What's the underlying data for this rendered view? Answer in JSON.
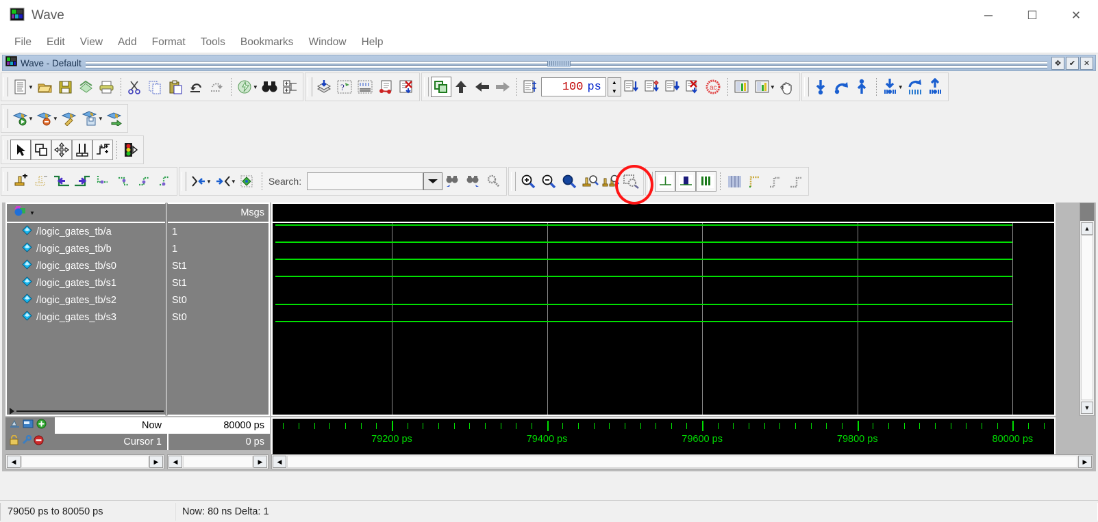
{
  "window": {
    "title": "Wave",
    "app_icon": "wave-window-icon",
    "controls": {
      "minimize": "─",
      "maximize": "☐",
      "close": "✕"
    }
  },
  "menubar": {
    "items": [
      "File",
      "Edit",
      "View",
      "Add",
      "Format",
      "Tools",
      "Bookmarks",
      "Window",
      "Help"
    ]
  },
  "pane": {
    "caption": "Wave - Default",
    "caption_icon": "wave-pane-icon",
    "buttons": [
      {
        "name": "undock-button",
        "glyph": "✥"
      },
      {
        "name": "dock-button",
        "glyph": "✔"
      },
      {
        "name": "close-pane-button",
        "glyph": "✕"
      }
    ]
  },
  "toolbars": {
    "standard": [
      {
        "name": "new-file-button",
        "icon": "new-document-icon",
        "dropdown": true
      },
      {
        "name": "open-file-button",
        "icon": "open-folder-icon"
      },
      {
        "name": "save-button",
        "icon": "floppy-disk-icon"
      },
      {
        "name": "reload-button",
        "icon": "reload-icon"
      },
      {
        "name": "print-button",
        "icon": "printer-icon"
      },
      {
        "name": "cut-button",
        "icon": "scissors-icon"
      },
      {
        "name": "copy-button",
        "icon": "copy-icon"
      },
      {
        "name": "paste-button",
        "icon": "clipboard-paste-icon"
      },
      {
        "name": "undo-button",
        "icon": "undo-arrow-icon"
      },
      {
        "name": "redo-button",
        "icon": "redo-arrow-icon"
      },
      {
        "name": "compile-button",
        "icon": "compile-icon",
        "dropdown": true
      },
      {
        "name": "find-button",
        "icon": "binoculars-icon"
      },
      {
        "name": "properties-button",
        "icon": "properties-icon"
      }
    ],
    "simulate": [
      {
        "name": "add-wave-button",
        "icon": "add-wave-icon"
      },
      {
        "name": "simulate-button",
        "icon": "simulate-icon"
      },
      {
        "name": "signal-list-button",
        "icon": "signal-list-icon"
      },
      {
        "name": "dataflow-button",
        "icon": "dataflow-icon"
      },
      {
        "name": "remove-button",
        "icon": "remove-x-icon"
      }
    ],
    "run": [
      {
        "name": "restart-button",
        "icon": "restart-icon",
        "pressed": true
      },
      {
        "name": "run-up-button",
        "icon": "arrow-up-icon"
      },
      {
        "name": "run-back-button",
        "icon": "arrow-left-icon"
      },
      {
        "name": "run-forward-button",
        "icon": "arrow-right-icon"
      },
      {
        "name": "run-length-button",
        "icon": "run-length-icon"
      }
    ],
    "run_length": {
      "value": "100",
      "unit": "ps",
      "name": "run-length-field"
    },
    "step": [
      {
        "name": "step-into-button",
        "icon": "step-into-icon"
      },
      {
        "name": "step-over-button",
        "icon": "step-over-icon"
      },
      {
        "name": "step-out-button",
        "icon": "step-out-icon"
      },
      {
        "name": "break-button",
        "icon": "break-x-icon"
      },
      {
        "name": "stop-button",
        "icon": "stop-sign-icon"
      }
    ],
    "wave_cmp": [
      {
        "name": "wave-compare-button",
        "icon": "wave-compare-icon"
      },
      {
        "name": "wave-compare-2-button",
        "icon": "wave-compare-2-icon",
        "dropdown": true
      },
      {
        "name": "pan-hand-button",
        "icon": "hand-pan-icon"
      }
    ],
    "bookmarks": [
      {
        "name": "collapse-all-button",
        "icon": "collapse-down-icon"
      },
      {
        "name": "expand-toggle-button",
        "icon": "expand-toggle-icon"
      },
      {
        "name": "expand-all-button",
        "icon": "expand-up-icon"
      },
      {
        "name": "collapse-sel-button",
        "icon": "collapse-sel-icon",
        "dropdown": true
      },
      {
        "name": "toggle-sel-button",
        "icon": "toggle-sel-icon"
      },
      {
        "name": "expand-sel-button",
        "icon": "expand-sel-icon"
      }
    ],
    "wave_row2": [
      {
        "name": "wave-run-button",
        "icon": "wave-run-icon",
        "dropdown": true
      },
      {
        "name": "wave-stop-button",
        "icon": "wave-stop-icon",
        "dropdown": true
      },
      {
        "name": "wave-edit-button",
        "icon": "wave-edit-icon"
      },
      {
        "name": "wave-save-button",
        "icon": "wave-save-icon",
        "dropdown": true
      },
      {
        "name": "wave-export-button",
        "icon": "wave-export-icon"
      }
    ],
    "edit_mode": [
      {
        "name": "select-mode-button",
        "icon": "arrow-cursor-icon",
        "pressed": true
      },
      {
        "name": "zoom-select-button",
        "icon": "zoom-rect-icon"
      },
      {
        "name": "edit-move-button",
        "icon": "move-cross-icon"
      },
      {
        "name": "edit-insert-button",
        "icon": "insert-pulse-icon"
      },
      {
        "name": "edit-props-button",
        "icon": "edit-props-icon"
      },
      {
        "name": "traffic-light-button",
        "icon": "traffic-light-icon"
      }
    ],
    "wave_edit": [
      {
        "name": "insert-cursor-button",
        "icon": "insert-cursor-icon"
      },
      {
        "name": "delete-cursor-button",
        "icon": "delete-cursor-icon"
      },
      {
        "name": "find-prev-transition-button",
        "icon": "prev-transition-icon"
      },
      {
        "name": "find-next-transition-button",
        "icon": "next-transition-icon"
      },
      {
        "name": "edge-1-button",
        "icon": "edge-dotted-1-icon"
      },
      {
        "name": "edge-2-button",
        "icon": "edge-dotted-2-icon"
      },
      {
        "name": "edge-3-button",
        "icon": "edge-dotted-3-icon"
      },
      {
        "name": "edge-4-button",
        "icon": "edge-dotted-4-icon"
      }
    ],
    "expand_time": [
      {
        "name": "expand-time-prev-button",
        "icon": "expand-time-prev-icon",
        "dropdown": true
      },
      {
        "name": "expand-time-next-button",
        "icon": "expand-time-next-icon",
        "dropdown": true
      },
      {
        "name": "expand-time-all-button",
        "icon": "expand-time-all-icon"
      }
    ],
    "search": {
      "label": "Search:",
      "value": "",
      "placeholder": "",
      "dropdown_icon": "chevron-down-icon",
      "buttons": [
        {
          "name": "search-prev-button",
          "icon": "search-prev-icon"
        },
        {
          "name": "search-next-button",
          "icon": "search-next-icon"
        },
        {
          "name": "search-options-button",
          "icon": "search-options-icon"
        }
      ]
    },
    "zoom": [
      {
        "name": "zoom-in-button",
        "icon": "zoom-in-icon"
      },
      {
        "name": "zoom-out-button",
        "icon": "zoom-out-icon"
      },
      {
        "name": "zoom-full-button",
        "icon": "zoom-full-icon",
        "highlighted": true
      },
      {
        "name": "zoom-cursor-button",
        "icon": "zoom-cursor-icon"
      },
      {
        "name": "zoom-range-button",
        "icon": "zoom-range-icon"
      },
      {
        "name": "zoom-select-area-button",
        "icon": "zoom-select-area-icon"
      }
    ],
    "format": [
      {
        "name": "format-single-button",
        "icon": "format-single-icon"
      },
      {
        "name": "format-dual-button",
        "icon": "format-dual-icon"
      },
      {
        "name": "format-multi-button",
        "icon": "format-multi-icon"
      },
      {
        "name": "grid-button",
        "icon": "grid-icon"
      },
      {
        "name": "wave-style-1-button",
        "icon": "wave-style-1-icon"
      },
      {
        "name": "wave-style-2-button",
        "icon": "wave-style-2-icon"
      },
      {
        "name": "wave-style-3-button",
        "icon": "wave-style-3-icon"
      }
    ]
  },
  "signal_pane": {
    "header_icon": "objects-filter-icon",
    "header_dropdown_icon": "chevron-down-icon",
    "values_header": "Msgs",
    "signals": [
      {
        "name": "/logic_gates_tb/a",
        "value": "1",
        "level": "high",
        "icon": "signal-diamond-icon"
      },
      {
        "name": "/logic_gates_tb/b",
        "value": "1",
        "level": "high",
        "icon": "signal-diamond-icon"
      },
      {
        "name": "/logic_gates_tb/s0",
        "value": "St1",
        "level": "high",
        "icon": "signal-diamond-icon"
      },
      {
        "name": "/logic_gates_tb/s1",
        "value": "St1",
        "level": "high",
        "icon": "signal-diamond-icon"
      },
      {
        "name": "/logic_gates_tb/s2",
        "value": "St0",
        "level": "low",
        "icon": "signal-diamond-icon"
      },
      {
        "name": "/logic_gates_tb/s3",
        "value": "St0",
        "level": "low",
        "icon": "signal-diamond-icon"
      }
    ]
  },
  "wave_data": {
    "trace_color": "#00e000",
    "background": "#000000",
    "gridline_color": "#8c8c8c",
    "time_start_ps": 79050,
    "time_end_ps": 80050,
    "gridline_times_ps": [
      79200,
      79400,
      79600,
      79800,
      80000
    ],
    "ruler_labels": [
      {
        "time_ps": 79200,
        "text": "79200 ps"
      },
      {
        "time_ps": 79400,
        "text": "79400 ps"
      },
      {
        "time_ps": 79600,
        "text": "79600 ps"
      },
      {
        "time_ps": 79800,
        "text": "79800 ps"
      },
      {
        "time_ps": 80000,
        "text": "80000 ps"
      }
    ],
    "minor_tick_interval_ps": 20,
    "major_tick_interval_ps": 200,
    "data_end_ps": 80000
  },
  "now_panel": {
    "now": {
      "label": "Now",
      "value": "80000 ps",
      "icons": [
        "now-marker-icon",
        "now-window-icon",
        "now-add-icon"
      ]
    },
    "cursor": {
      "label": "Cursor 1",
      "value": "0 ps",
      "icons": [
        "lock-icon",
        "wrench-icon",
        "delete-cursor-icon"
      ]
    }
  },
  "scrollbars": {
    "left_arrow": "◀",
    "right_arrow": "▶",
    "up_arrow": "▲",
    "down_arrow": "▼"
  },
  "statusbar": {
    "range": "79050 ps to 80050 ps",
    "now_delta": "Now: 80 ns   Delta: 1"
  }
}
